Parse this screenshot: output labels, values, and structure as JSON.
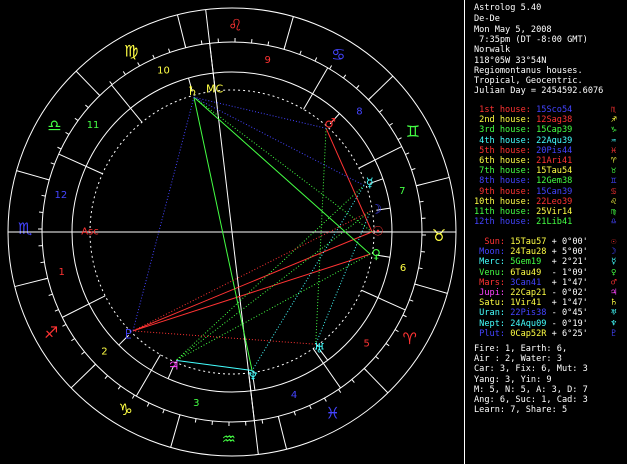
{
  "header": {
    "app": "Astrolog 5.40",
    "name": "De-De",
    "date": "Mon May 5, 2008",
    "time": " 7:35pm (DT -8:00 GMT)",
    "place": "Norwalk",
    "coords": "118°05W 33°54N",
    "house_system": "Regiomontanus houses.",
    "zodiac": "Tropical, Geocentric.",
    "julian": "Julian Day = 2454592.6076"
  },
  "houses": [
    {
      "label": "1st house:",
      "value": "15Sco54",
      "sym": "♏",
      "color": "#ff3333",
      "vcolor": "#4444ff"
    },
    {
      "label": "2nd house:",
      "value": "12Sag38",
      "sym": "♐",
      "color": "#ffff44",
      "vcolor": "#ff3333"
    },
    {
      "label": "3rd house:",
      "value": "15Cap39",
      "sym": "♑",
      "color": "#44ff44",
      "vcolor": "#44ff44"
    },
    {
      "label": "4th house:",
      "value": "22Aqu39",
      "sym": "♒",
      "color": "#44ffff",
      "vcolor": "#44ffff"
    },
    {
      "label": "5th house:",
      "value": "20Pis44",
      "sym": "♓",
      "color": "#ff3333",
      "vcolor": "#4444ff"
    },
    {
      "label": "6th house:",
      "value": "21Ari41",
      "sym": "♈",
      "color": "#ffff44",
      "vcolor": "#ff3333"
    },
    {
      "label": "7th house:",
      "value": "15Tau54",
      "sym": "♉",
      "color": "#44ff44",
      "vcolor": "#ffff44"
    },
    {
      "label": "8th house:",
      "value": "12Gem38",
      "sym": "♊",
      "color": "#4444ff",
      "vcolor": "#44ff44"
    },
    {
      "label": "9th house:",
      "value": "15Can39",
      "sym": "♋",
      "color": "#ff3333",
      "vcolor": "#4444ff"
    },
    {
      "label": "10th house:",
      "value": "22Leo39",
      "sym": "♌",
      "color": "#ffff44",
      "vcolor": "#ff3333"
    },
    {
      "label": "11th house:",
      "value": "25Vir14",
      "sym": "♍",
      "color": "#44ff44",
      "vcolor": "#ffff44"
    },
    {
      "label": "12th house:",
      "value": "21Lib41",
      "sym": "♎",
      "color": "#4444ff",
      "vcolor": "#44ff44"
    }
  ],
  "planets": [
    {
      "label": "Sun:",
      "value": "15Tau57",
      "lat": "+ 0°00'",
      "sym": "☉",
      "color": "#ff3333",
      "vcolor": "#ffff44"
    },
    {
      "label": "Moon:",
      "value": "24Tau28",
      "lat": "+ 5°00'",
      "sym": "☽",
      "color": "#4444ff",
      "vcolor": "#ffff44"
    },
    {
      "label": "Merc:",
      "value": "5Gem19",
      "lat": "+ 2°21'",
      "sym": "☿",
      "color": "#44ffff",
      "vcolor": "#44ff44"
    },
    {
      "label": "Venu:",
      "value": "6Tau49",
      "lat": "- 1°09'",
      "sym": "♀",
      "color": "#44ff44",
      "vcolor": "#ffff44"
    },
    {
      "label": "Mars:",
      "value": "3Can41",
      "lat": "+ 1°47'",
      "sym": "♂",
      "color": "#ff3333",
      "vcolor": "#4444ff"
    },
    {
      "label": "Jupi:",
      "value": "22Cap21",
      "lat": "- 0°02'",
      "sym": "♃",
      "color": "#ff44ff",
      "vcolor": "#ffff44"
    },
    {
      "label": "Satu:",
      "value": "1Vir41",
      "lat": "+ 1°47'",
      "sym": "♄",
      "color": "#ffff44",
      "vcolor": "#ffff44"
    },
    {
      "label": "Uran:",
      "value": "22Pis38",
      "lat": "- 0°45'",
      "sym": "♅",
      "color": "#44ffff",
      "vcolor": "#4444ff"
    },
    {
      "label": "Nept:",
      "value": "24Aqu09",
      "lat": "- 0°19'",
      "sym": "♆",
      "color": "#44ffff",
      "vcolor": "#44ffff"
    },
    {
      "label": "Plut:",
      "value": "0Cap52R",
      "lat": "+ 6°25'",
      "sym": "♇",
      "color": "#4444ff",
      "vcolor": "#ffff44"
    }
  ],
  "stats": [
    "Fire: 1, Earth: 6,",
    "Air : 2, Water: 3",
    "Car: 3, Fix: 6, Mut: 3",
    "Yang: 3, Yin: 9",
    "M: 5, N: 5, A: 3, D: 7",
    "Ang: 6, Suc: 1, Cad: 3",
    "Learn: 7, Share: 5"
  ],
  "wheel": {
    "asc_label": "Asc",
    "mc_label": "MC",
    "signs": [
      "♈",
      "♉",
      "♊",
      "♋",
      "♌",
      "♍",
      "♎",
      "♏",
      "♐",
      "♑",
      "♒",
      "♓"
    ],
    "sign_colors": [
      "#ff3333",
      "#ffff44",
      "#44ff44",
      "#4444ff",
      "#ff3333",
      "#ffff44",
      "#44ff44",
      "#4444ff",
      "#ff3333",
      "#ffff44",
      "#44ff44",
      "#4444ff"
    ],
    "house_numbers": [
      "1",
      "2",
      "3",
      "4",
      "5",
      "6",
      "7",
      "8",
      "9",
      "10",
      "11",
      "12"
    ],
    "house_num_colors": [
      "#ff3333",
      "#ffff44",
      "#44ff44",
      "#4444ff",
      "#ff3333",
      "#ffff44",
      "#44ff44",
      "#4444ff",
      "#ff3333",
      "#ffff44",
      "#44ff44",
      "#4444ff"
    ],
    "cusps_deg": [
      225.9,
      252.6,
      285.65,
      322.65,
      350.73,
      21.68,
      45.9,
      72.63,
      105.65,
      142.65,
      175.23,
      201.68
    ],
    "planet_deg": [
      45.95,
      54.47,
      65.32,
      36.82,
      93.68,
      292.35,
      151.68,
      352.63,
      324.15,
      270.87
    ],
    "aspects": [
      {
        "a": 0,
        "b": 4,
        "color": "#ff3333",
        "style": "solid"
      },
      {
        "a": 0,
        "b": 9,
        "color": "#ff3333",
        "style": "solid"
      },
      {
        "a": 3,
        "b": 9,
        "color": "#ff3333",
        "style": "solid"
      },
      {
        "a": 1,
        "b": 7,
        "color": "#44ffff",
        "style": "dot"
      },
      {
        "a": 5,
        "b": 8,
        "color": "#44ffff",
        "style": "solid"
      },
      {
        "a": 3,
        "b": 6,
        "color": "#44ff44",
        "style": "solid"
      },
      {
        "a": 6,
        "b": 8,
        "color": "#44ff44",
        "style": "solid"
      },
      {
        "a": 0,
        "b": 6,
        "color": "#44ff44",
        "style": "dot"
      },
      {
        "a": 2,
        "b": 5,
        "color": "#44ff44",
        "style": "dot"
      },
      {
        "a": 4,
        "b": 7,
        "color": "#44ff44",
        "style": "dot"
      },
      {
        "a": 1,
        "b": 5,
        "color": "#44ff44",
        "style": "dot"
      },
      {
        "a": 3,
        "b": 5,
        "color": "#44ff44",
        "style": "dot"
      },
      {
        "a": 2,
        "b": 6,
        "color": "#4444ff",
        "style": "dot"
      },
      {
        "a": 4,
        "b": 6,
        "color": "#4444ff",
        "style": "dot"
      },
      {
        "a": 6,
        "b": 9,
        "color": "#4444ff",
        "style": "dot"
      },
      {
        "a": 7,
        "b": 9,
        "color": "#ff3333",
        "style": "dot"
      },
      {
        "a": 2,
        "b": 8,
        "color": "#44ffff",
        "style": "dot"
      },
      {
        "a": 1,
        "b": 9,
        "color": "#ff3333",
        "style": "dot"
      }
    ]
  }
}
